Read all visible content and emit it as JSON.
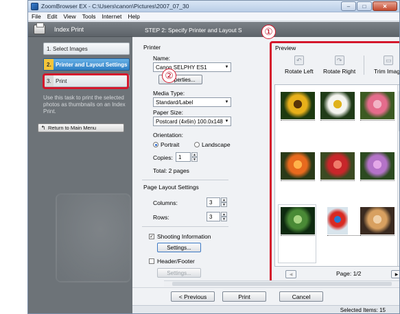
{
  "window": {
    "title": "ZoomBrowser EX - C:\\Users\\canon\\Pictures\\2007_07_30",
    "buttons": [
      "–",
      "□",
      "✕"
    ]
  },
  "menu": [
    "File",
    "Edit",
    "View",
    "Tools",
    "Internet",
    "Help"
  ],
  "left": {
    "title": "Index Print",
    "steps": [
      {
        "num": "1.",
        "label": "Select Images"
      },
      {
        "num": "2.",
        "label": "Printer and Layout Settings"
      },
      {
        "num": "3.",
        "label": "Print"
      }
    ],
    "description": "Use this task to print the selected photos as thumbnails on an Index Print.",
    "return_label": "Return to Main Menu"
  },
  "annotations": {
    "one": "①",
    "two": "②"
  },
  "main": {
    "title": "STEP 2: Specify Printer and Layout S"
  },
  "printer": {
    "section": "Printer",
    "name_label": "Name:",
    "name_value": "Canon SELPHY ES1",
    "properties_button": "Properties...",
    "media_label": "Media Type:",
    "media_value": "Standard/Label",
    "paper_label": "Paper Size:",
    "paper_value": "Postcard (4x6in) 100.0x148.0",
    "orientation_label": "Orientation:",
    "portrait": "Portrait",
    "landscape": "Landscape",
    "copies_label": "Copies:",
    "copies_value": "1",
    "total": "Total: 2 pages"
  },
  "layout": {
    "section": "Page Layout Settings",
    "columns_label": "Columns:",
    "columns_value": "3",
    "rows_label": "Rows:",
    "rows_value": "3",
    "shooting_info": "Shooting Information",
    "settings_button": "Settings...",
    "header_footer": "Header/Footer",
    "settings_button_2": "Settings..."
  },
  "preview": {
    "title": "Preview",
    "rotate_left": "Rotate Left",
    "rotate_right": "Rotate Right",
    "trim_image": "Trim Image",
    "page_label": "Page: 1/2"
  },
  "thumbnails": [
    {
      "name": "sunflower",
      "colors": [
        "#1d3a10",
        "#e8b01a",
        "#5a3408"
      ]
    },
    {
      "name": "white-daisy",
      "colors": [
        "#203b18",
        "#f4f4ef",
        "#e0b21c"
      ]
    },
    {
      "name": "pink-flowers",
      "colors": [
        "#3c5a22",
        "#e46c8c",
        "#f2b3c6"
      ]
    },
    {
      "name": "orange-lilies",
      "colors": [
        "#2a3a18",
        "#e86a1e",
        "#ffb24a"
      ]
    },
    {
      "name": "red-flowers",
      "colors": [
        "#3b4a22",
        "#c8262a",
        "#f07a6a"
      ]
    },
    {
      "name": "purple-flowers",
      "colors": [
        "#2c4a20",
        "#b473c8",
        "#e4a8e8"
      ]
    },
    {
      "name": "green-leaves",
      "colors": [
        "#0e2a10",
        "#4a8a36",
        "#a8d482"
      ]
    },
    {
      "name": "parrot",
      "colors": [
        "#d8e4ec",
        "#d82a22",
        "#2a7ad0"
      ]
    },
    {
      "name": "kitten",
      "colors": [
        "#3a2a20",
        "#d8a060",
        "#f0d0a8"
      ]
    }
  ],
  "buttons": {
    "previous": "< Previous",
    "print": "Print",
    "cancel": "Cancel"
  },
  "status": {
    "selected": "Selected Items: 15"
  }
}
